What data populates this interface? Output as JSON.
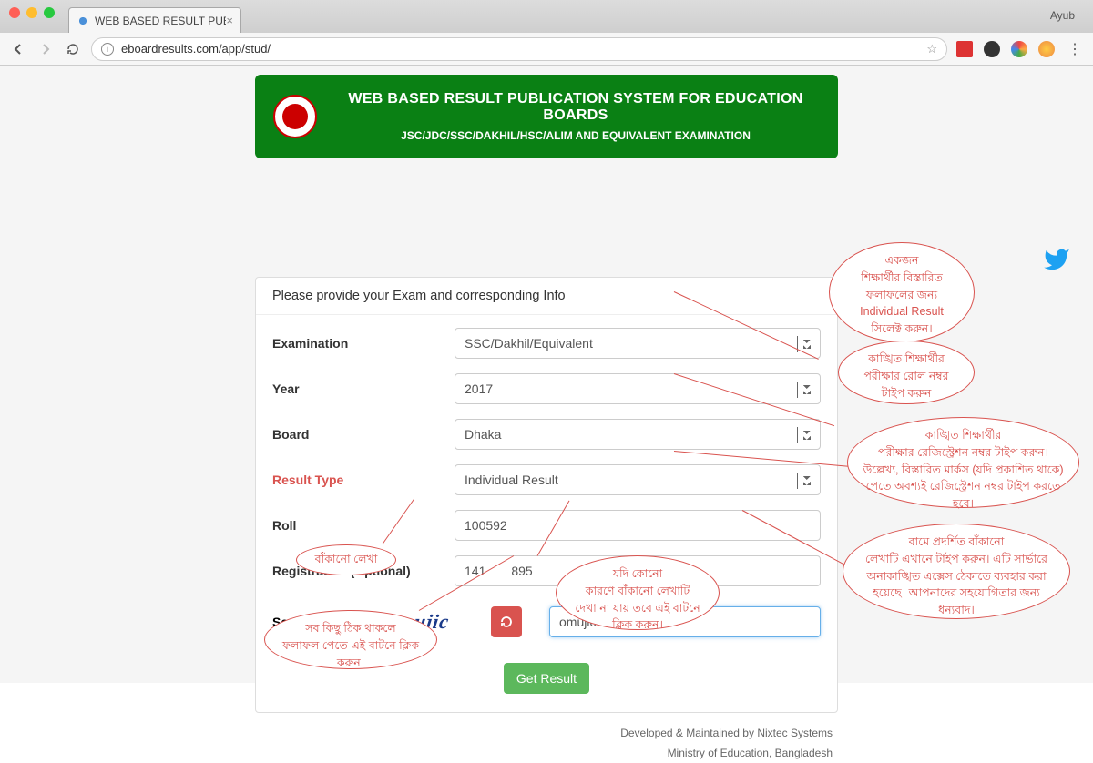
{
  "browser": {
    "tab_title": "WEB BASED RESULT PUBLICA",
    "url": "eboardresults.com/app/stud/",
    "profile": "Ayub"
  },
  "header": {
    "title": "WEB BASED RESULT PUBLICATION SYSTEM FOR EDUCATION BOARDS",
    "subtitle": "JSC/JDC/SSC/DAKHIL/HSC/ALIM AND EQUIVALENT EXAMINATION"
  },
  "panel": {
    "heading": "Please provide your Exam and corresponding Info"
  },
  "form": {
    "examination": {
      "label": "Examination",
      "value": "SSC/Dakhil/Equivalent"
    },
    "year": {
      "label": "Year",
      "value": "2017"
    },
    "board": {
      "label": "Board",
      "value": "Dhaka"
    },
    "result_type": {
      "label": "Result Type",
      "value": "Individual Result"
    },
    "roll": {
      "label": "Roll",
      "value": "100592"
    },
    "registration": {
      "label": "Registration (Optional)",
      "value_left": "141",
      "value_right": "895"
    },
    "security": {
      "label": "Security Key",
      "captcha_text": "omujic",
      "input_value": "omujic"
    },
    "submit_label": "Get Result"
  },
  "footer": {
    "line1": "Developed & Maintained by Nixtec Systems",
    "line2": "Ministry of Education, Bangladesh"
  },
  "annotations": {
    "a1": "একজন\nশিক্ষার্থীর বিস্তারিত\nফলাফলের জন্য\nIndividual Result\nসিলেক্ট করুন।",
    "a2": "কাঙ্খিত শিক্ষার্থীর\nপরীক্ষার রোল নম্বর\nটাইপ করুন",
    "a3": "কাঙ্খিত শিক্ষার্থীর\nপরীক্ষার রেজিস্ট্রেশন নম্বর টাইপ করুন।\nউল্লেখ্য, বিস্তারিত মার্কস (যদি প্রকাশিত থাকে)\nপেতে অবশ্যই রেজিস্ট্রেশন নম্বর টাইপ করতে\nহবে।",
    "a4": "বামে প্রদর্শিত বাঁকানো\nলেখাটি এখানে টাইপ করুন। এটি সার্ভারে\nঅনাকাঙ্খিত এক্সেস ঠেকাতে ব্যবহার করা\nহয়েছে। আপনাদের সহযোগিতার জন্য\nধন্যবাদ।",
    "a5": "বাঁকানো লেখা",
    "a6": "সব কিছু ঠিক থাকলে\nফলাফল পেতে এই  বাটনে ক্লিক\nকরুন।",
    "a7": "যদি কোনো\nকারণে বাঁকানো  লেখাটি\nদেখা না যায় তবে এই বাটনে\nক্লিক করুন।"
  }
}
